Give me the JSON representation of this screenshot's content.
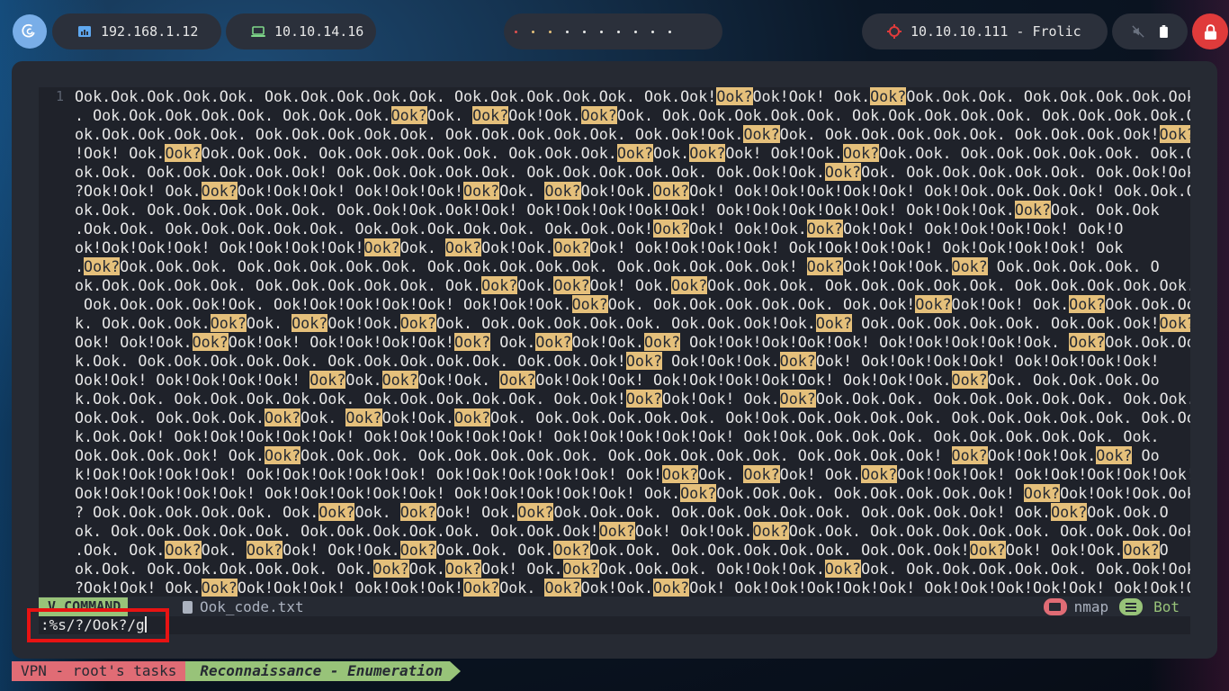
{
  "topbar": {
    "logo_icon": "debian-swirl-icon",
    "local_ip": "192.168.1.12",
    "vpn_ip": "10.10.14.16",
    "target": "10.10.10.111 - Frolic",
    "workspace_dot_colors": [
      "#e05050",
      "#e5c07b",
      "#e5c07b",
      "#e7e7e7",
      "#e7e7e7",
      "#e7e7e7",
      "#e7e7e7",
      "#e7e7e7",
      "#e7e7e7",
      "#e7e7e7"
    ],
    "volume_icon": "muted-speaker-icon",
    "battery_icon": "battery-icon",
    "power_icon": "lock-icon",
    "accent_red": "#e03b3b"
  },
  "editor": {
    "line_number": "1",
    "file_lines": [
      "Ook.Ook.Ook.Ook.Ook. Ook.Ook.Ook.Ook.Ook. Ook.Ook.Ook.Ook.Ook. Ook.Ook!Ook?Ook!Ook! Ook.Ook?Ook.Ook.Ook. Ook.Ook.Ook.Ook.Ook",
      ". Ook.Ook.Ook.Ook.Ook. Ook.Ook.Ook.Ook?Ook. Ook?Ook!Ook.Ook?Ook. Ook.Ook.Ook.Ook.Ook. Ook.Ook.Ook.Ook.Ook. Ook.Ook.Ook.Ook.O",
      "ok.Ook.Ook.Ook.Ook. Ook.Ook.Ook.Ook.Ook. Ook.Ook.Ook.Ook.Ook. Ook.Ook!Ook.Ook?Ook. Ook.Ook.Ook.Ook.Ook. Ook.Ook.Ook.Ook!Ook?Ook",
      "!Ook! Ook.Ook?Ook.Ook.Ook. Ook.Ook.Ook.Ook.Ook. Ook.Ook.Ook.Ook?Ook.Ook?Ook! Ook!Ook.Ook?Ook.Ook. Ook.Ook.Ook.Ook.Ook. Ook.Ook.Ook.O",
      "ok.Ook. Ook.Ook.Ook.Ook.Ook! Ook.Ook.Ook.Ook.Ook. Ook.Ook.Ook.Ook.Ook. Ook.Ook!Ook.Ook?Ook. Ook.Ook.Ook.Ook.Ook. Ook.Ook!Ook",
      "?Ook!Ook! Ook.Ook?Ook!Ook!Ook! Ook!Ook!Ook!Ook?Ook. Ook?Ook!Ook.Ook?Ook! Ook!Ook!Ook!Ook!Ook! Ook!Ook.Ook.Ook.Ook! Ook.Ook.O",
      "ok.Ook. Ook.Ook.Ook.Ook.Ook. Ook.Ook!Ook.Ook!Ook! Ook!Ook!Ook!Ook!Ook! Ook!Ook!Ook!Ook!Ook! Ook!Ook!Ook.Ook?Ook. Ook.Ook",
      ".Ook.Ook. Ook.Ook.Ook.Ook.Ook. Ook.Ook.Ook.Ook.Ook. Ook.Ook.Ook!Ook?Ook! Ook!Ook.Ook?Ook!Ook! Ook!Ook!Ook!Ook! Ook!O",
      "ok!Ook!Ook!Ook! Ook!Ook!Ook!Ook!Ook?Ook. Ook?Ook!Ook.Ook?Ook! Ook!Ook!Ook!Ook! Ook!Ook!Ook!Ook! Ook!Ook!Ook!Ook! Ook",
      ".Ook?Ook.Ook.Ook. Ook.Ook.Ook.Ook.Ook. Ook.Ook.Ook.Ook.Ook. Ook.Ook.Ook.Ook.Ook! Ook?Ook!Ook!Ook.Ook? Ook.Ook.Ook.Ook. O",
      "ok.Ook.Ook.Ook.Ook. Ook.Ook.Ook.Ook.Ook. Ook.Ook?Ook.Ook?Ook! Ook.Ook?Ook.Ook.Ook. Ook.Ook.Ook.Ook.Ook. Ook.Ook.Ook.Ook.Ook.",
      " Ook.Ook.Ook.Ook!Ook. Ook!Ook!Ook!Ook!Ook! Ook!Ook!Ook.Ook?Ook. Ook.Ook.Ook.Ook.Ook. Ook.Ook!Ook?Ook!Ook! Ook.Ook?Ook.Ook.Oo",
      "k. Ook.Ook.Ook.Ook?Ook. Ook?Ook!Ook.Ook?Ook. Ook.Ook.Ook.Ook.Ook. Ook.Ook.Ook!Ook.Ook? Ook.Ook.Ook.Ook.Ook. Ook.Ook.Ook!Ook?",
      "Ook! Ook!Ook.Ook?Ook!Ook! Ook!Ook!Ook!Ook!Ook? Ook.Ook?Ook!Ook.Ook? Ook!Ook!Ook!Ook!Ook! Ook!Ook!Ook!Ook!Ook. Ook?Ook.Ook.Oo",
      "k.Ook. Ook.Ook.Ook.Ook.Ook. Ook.Ook.Ook.Ook.Ook. Ook.Ook.Ook!Ook? Ook!Ook!Ook.Ook?Ook! Ook!Ook!Ook!Ook! Ook!Ook!Ook!Ook!",
      "Ook!Ook! Ook!Ook!Ook!Ook! Ook?Ook.Ook?Ook!Ook. Ook?Ook!Ook!Ook! Ook!Ook!Ook!Ook!Ook! Ook!Ook!Ook.Ook?Ook. Ook.Ook.Ook.Oo",
      "k.Ook.Ook. Ook.Ook.Ook.Ook.Ook. Ook.Ook.Ook.Ook.Ook. Ook.Ook!Ook?Ook!Ook! Ook.Ook?Ook.Ook.Ook. Ook.Ook.Ook.Ook.Ook. Ook.Ook.",
      "Ook.Ook. Ook.Ook.Ook.Ook?Ook. Ook?Ook!Ook.Ook?Ook. Ook.Ook.Ook.Ook.Ook. Ook!Ook.Ook.Ook.Ook.Ook. Ook.Ook.Ook.Ook.Ook. Ook.Oo",
      "k.Ook.Ook! Ook!Ook!Ook!Ook!Ook! Ook!Ook!Ook!Ook!Ook! Ook!Ook!Ook!Ook!Ook! Ook!Ook.Ook.Ook.Ook. Ook.Ook.Ook.Ook.Ook. Ook.",
      "Ook.Ook.Ook.Ook! Ook.Ook?Ook.Ook.Ook. Ook.Ook.Ook.Ook.Ook. Ook.Ook.Ook.Ook.Ook. Ook.Ook.Ook.Ook! Ook?Ook!Ook!Ook.Ook? Oo",
      "k!Ook!Ook!Ook!Ook! Ook!Ook!Ook!Ook!Ook! Ook!Ook!Ook!Ook!Ook! Ook!Ook?Ook. Ook?Ook! Ook.Ook?Ook!Ook!Ook! Ook!Ook!Ook!Ook!Ook!",
      "Ook!Ook!Ook!Ook!Ook! Ook!Ook!Ook!Ook!Ook! Ook!Ook!Ook!Ook!Ook! Ook.Ook?Ook.Ook.Ook. Ook.Ook.Ook.Ook.Ook! Ook?Ook!Ook!Ook.Ook",
      "? Ook.Ook.Ook.Ook.Ook. Ook.Ook?Ook. Ook?Ook! Ook.Ook?Ook.Ook.Ook. Ook.Ook.Ook.Ook.Ook. Ook.Ook.Ook.Ook! Ook.Ook?Ook.Ook.O",
      "ok. Ook.Ook.Ook.Ook.Ook. Ook.Ook.Ook.Ook.Ook. Ook.Ook.Ook!Ook?Ook! Ook!Ook.Ook?Ook.Ook. Ook.Ook.Ook.Ook.Ook. Ook.Ook.Ook.Ook",
      ".Ook. Ook.Ook?Ook. Ook?Ook! Ook!Ook.Ook?Ook.Ook. Ook.Ook?Ook.Ook. Ook.Ook.Ook.Ook.Ook. Ook.Ook.Ook!Ook?Ook! Ook!Ook.Ook?O",
      "ok.Ook. Ook.Ook.Ook.Ook.Ook. Ook.Ook?Ook.Ook?Ook! Ook.Ook?Ook.Ook.Ook. Ook!Ook!Ook.Ook?Ook. Ook.Ook.Ook.Ook.Ook. Ook.Ook!Ook",
      "?Ook!Ook! Ook.Ook?Ook!Ook!Ook! Ook!Ook!Ook!Ook?Ook. Ook?Ook!Ook.Ook?Ook! Ook!Ook!Ook!Ook!Ook! Ook!Ook!Ook!Ook!Ook! Ook!Ook!O"
    ],
    "highlight_term": "Ook?"
  },
  "statusline": {
    "mode": "COMMAND",
    "mode_icon": "vim-logo-icon",
    "filename": "Ook_code.txt",
    "file_icon": "file-icon",
    "folder_icon": "folder-icon",
    "session": "nmap",
    "position_icon": "lines-icon",
    "position": "Bot"
  },
  "command": {
    "text": ":%s/?/Ook?/g"
  },
  "tmux": {
    "session_label": "VPN - root's tasks",
    "window_label": "Reconnaissance - Enumeration"
  }
}
